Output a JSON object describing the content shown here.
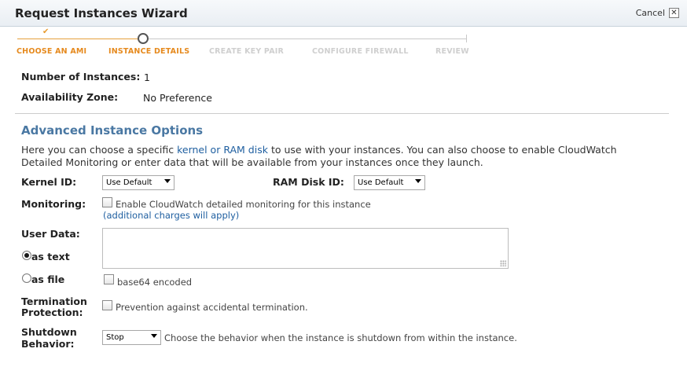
{
  "wizard": {
    "title": "Request Instances Wizard",
    "cancel_label": "Cancel",
    "cancel_icon_glyph": "✕"
  },
  "steps": [
    {
      "label": "CHOOSE AN AMI",
      "state": "done"
    },
    {
      "label": "INSTANCE DETAILS",
      "state": "current"
    },
    {
      "label": "CREATE KEY PAIR",
      "state": "todo"
    },
    {
      "label": "CONFIGURE FIREWALL",
      "state": "todo"
    },
    {
      "label": "REVIEW",
      "state": "todo"
    }
  ],
  "step_check_glyph": "✔",
  "details": {
    "instances_label": "Number of Instances:",
    "instances_value": "1",
    "zone_label": "Availability Zone:",
    "zone_value": "No Preference"
  },
  "advanced": {
    "heading": "Advanced Instance Options",
    "desc_before": "Here you can choose a specific ",
    "desc_link": "kernel or RAM disk",
    "desc_after": " to use with your instances. You can also choose to enable CloudWatch Detailed Monitoring or enter data that will be available from your instances once they launch.",
    "kernel_label": "Kernel ID:",
    "kernel_value": "Use Default",
    "ramdisk_label": "RAM Disk ID:",
    "ramdisk_value": "Use Default",
    "monitoring_label": "Monitoring:",
    "monitoring_checkbox": "Enable CloudWatch detailed monitoring for this instance",
    "monitoring_charges": "(additional charges will apply)",
    "userdata_label": "User Data:",
    "as_text_label": "as text",
    "as_file_label": "as file",
    "base64_label": "base64 encoded",
    "termination_label_1": "Termination",
    "termination_label_2": "Protection:",
    "termination_checkbox": "Prevention against accidental termination.",
    "shutdown_label_1": "Shutdown",
    "shutdown_label_2": "Behavior:",
    "shutdown_value": "Stop",
    "shutdown_help": "Choose the behavior when the instance is shutdown from within the instance."
  },
  "colors": {
    "accent_orange": "#e68a1e",
    "heading_blue": "#4a78a3",
    "link_blue": "#1f5fa0"
  }
}
